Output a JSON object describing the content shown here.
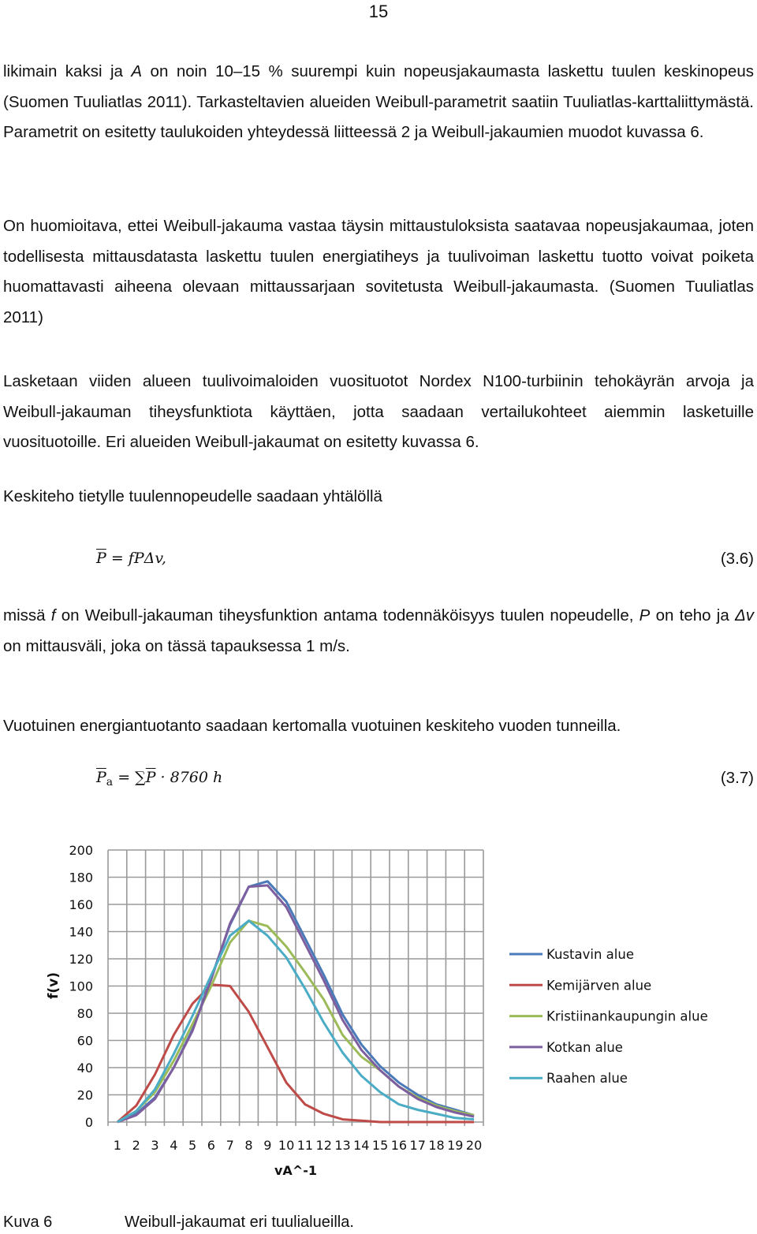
{
  "page_number": "15",
  "paragraphs": [
    {
      "id": "p1",
      "html_parts": [
        "likimain kaksi ja ",
        {
          "i": "A"
        },
        " on noin 10–15 % suurempi kuin nopeusjakaumasta laskettu tuulen keskinopeus (Suomen Tuuliatlas 2011). Tarkasteltavien alueiden Weibull-parametrit saatiin Tuuliatlas-karttaliittymästä. Parametrit on esitetty taulukoiden yhteydessä liitteessä 2 ja Weibull-jakaumien muodot kuvassa 6."
      ]
    },
    {
      "id": "p2",
      "html_parts": [
        "On huomioitava, ettei Weibull-jakauma vastaa täysin mittaustuloksista saatavaa nopeusjakaumaa, joten todellisesta mittausdatasta laskettu tuulen energiatiheys ja tuulivoiman laskettu tuotto voivat poiketa huomattavasti aiheena olevaan mittaussarjaan sovitetusta Weibull-jakaumasta. (Suomen Tuuliatlas 2011)"
      ]
    },
    {
      "id": "p3",
      "html_parts": [
        "Lasketaan viiden alueen tuulivoimaloiden vuosituotot Nordex N100-turbiinin tehokäyrän arvoja ja Weibull-jakauman tiheysfunktiota käyttäen, jotta saadaan vertailukohteet aiemmin lasketuille vuosituotoille. Eri alueiden Weibull-jakaumat on esitetty kuvassa 6."
      ]
    },
    {
      "id": "p4",
      "html_parts": [
        "Keskiteho tietylle tuulennopeudelle saadaan yhtälöllä"
      ]
    },
    {
      "id": "p5",
      "html_parts": [
        "missä ",
        {
          "i": "f"
        },
        " on Weibull-jakauman tiheysfunktion antama todennäköisyys tuulen nopeudelle, ",
        {
          "i": "P"
        },
        " on teho ja ",
        {
          "i": "Δv"
        },
        " on mittausväli, joka on tässä tapauksessa 1 m/s."
      ]
    },
    {
      "id": "p6",
      "html_parts": [
        "Vuotuinen energiantuotanto saadaan kertomalla vuotuinen keskiteho vuoden tunneilla."
      ]
    }
  ],
  "equations": [
    {
      "lhs": "P",
      "rhs": " = fPΔv,",
      "number": "(3.6)"
    },
    {
      "lhs": "P",
      "lhs_sub": "a",
      "rhs_sum": " = ∑",
      "rhs_bar": "P",
      "rhs": " · 8760 h",
      "number": "(3.7)"
    }
  ],
  "chart_data": {
    "type": "line",
    "title": "",
    "xlabel": "vA^-1",
    "ylabel": "f(v)",
    "x": [
      1,
      2,
      3,
      4,
      5,
      6,
      7,
      8,
      9,
      10,
      11,
      12,
      13,
      14,
      15,
      16,
      17,
      18,
      19,
      20
    ],
    "ylim": [
      0,
      200
    ],
    "yticks": [
      0,
      20,
      40,
      60,
      80,
      100,
      120,
      140,
      160,
      180,
      200
    ],
    "grid": true,
    "legend_position": "right",
    "series": [
      {
        "name": "Kustavin alue",
        "color": "#4a7ab8",
        "values": [
          0,
          6,
          18,
          40,
          68,
          106,
          145,
          173,
          177,
          162,
          135,
          108,
          79,
          57,
          41,
          29,
          20,
          13,
          9,
          5
        ]
      },
      {
        "name": "Kemijärven alue",
        "color": "#bf4b48",
        "values": [
          0,
          12,
          35,
          64,
          87,
          101,
          100,
          81,
          55,
          29,
          13,
          6,
          2,
          1,
          0,
          0,
          0,
          0,
          0,
          0
        ]
      },
      {
        "name": "Kristiinankaupungin alue",
        "color": "#9bbb59",
        "values": [
          0,
          8,
          22,
          45,
          72,
          100,
          132,
          148,
          144,
          129,
          110,
          90,
          64,
          48,
          38,
          26,
          18,
          12,
          8,
          5
        ]
      },
      {
        "name": "Kotkan alue",
        "color": "#7d5fa0",
        "values": [
          0,
          5,
          17,
          40,
          67,
          105,
          146,
          173,
          174,
          158,
          131,
          104,
          75,
          53,
          38,
          26,
          17,
          11,
          7,
          4
        ]
      },
      {
        "name": "Raahen alue",
        "color": "#4bacc6",
        "values": [
          0,
          8,
          24,
          50,
          78,
          108,
          137,
          148,
          137,
          121,
          98,
          73,
          51,
          34,
          22,
          13,
          9,
          6,
          3,
          2
        ]
      }
    ]
  },
  "caption": {
    "label": "Kuva 6",
    "text": "Weibull-jakaumat eri tuulialueilla."
  }
}
